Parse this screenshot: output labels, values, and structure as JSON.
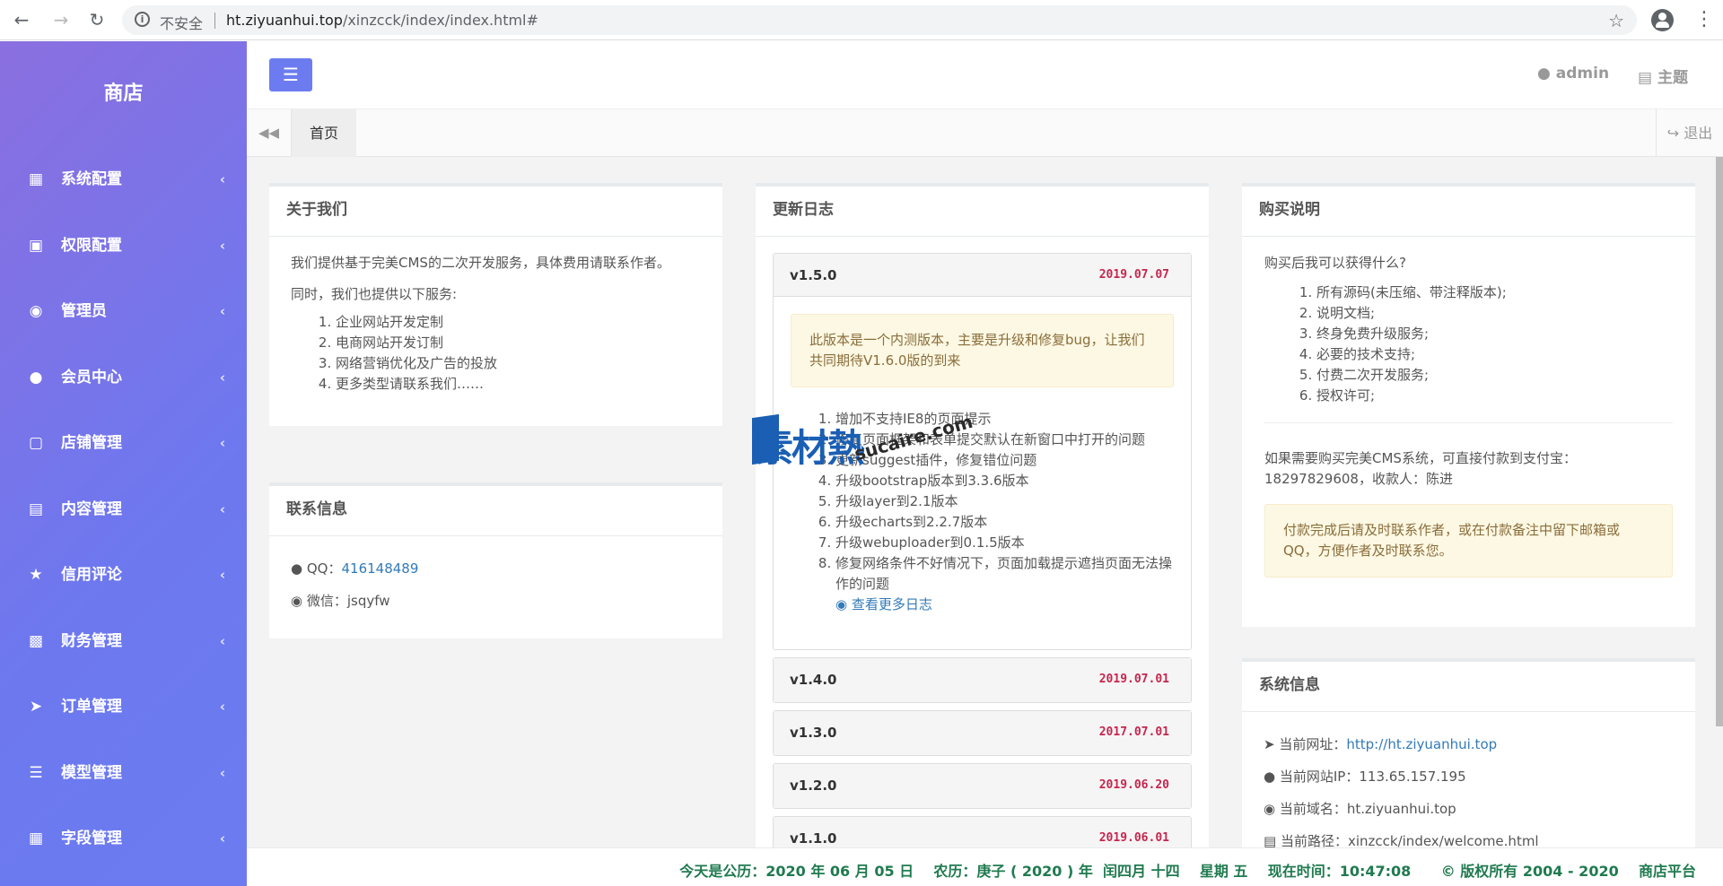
{
  "browser": {
    "insecure_label": "不安全",
    "url_host": "ht.ziyuanhui.top",
    "url_path": "/xinzcck/index/index.html#"
  },
  "sidebar": {
    "brand": "商店",
    "items": [
      {
        "label": "系统配置",
        "icon": "th-icon"
      },
      {
        "label": "权限配置",
        "icon": "lock-icon"
      },
      {
        "label": "管理员",
        "icon": "dot-circle-icon"
      },
      {
        "label": "会员中心",
        "icon": "user-icon"
      },
      {
        "label": "店铺管理",
        "icon": "store-icon"
      },
      {
        "label": "内容管理",
        "icon": "list-icon"
      },
      {
        "label": "信用评论",
        "icon": "star-icon"
      },
      {
        "label": "财务管理",
        "icon": "bar-chart-icon"
      },
      {
        "label": "订单管理",
        "icon": "paper-plane-icon"
      },
      {
        "label": "模型管理",
        "icon": "server-icon"
      },
      {
        "label": "字段管理",
        "icon": "grid-icon"
      }
    ]
  },
  "header": {
    "user": "admin",
    "theme": "主题"
  },
  "tabs": {
    "home": "首页",
    "logout": "退出"
  },
  "about": {
    "title": "关于我们",
    "intro": "我们提供基于完美CMS的二次开发服务，具体费用请联系作者。",
    "services_intro": "同时，我们也提供以下服务:",
    "services": [
      "企业网站开发定制",
      "电商网站开发订制",
      "网络营销优化及广告的投放",
      "更多类型请联系我们……"
    ]
  },
  "contact": {
    "title": "联系信息",
    "qq_label": "QQ：",
    "qq_value": "416148489",
    "wechat_label": "微信：",
    "wechat_value": "jsqyfw"
  },
  "changelog": {
    "title": "更新日志",
    "current": {
      "version": "v1.5.0",
      "date": "2019.07.07",
      "notice": "此版本是一个内测版本，主要是升级和修复bug，让我们共同期待V1.6.0版的到来",
      "items": [
        "增加不支持IE8的页面提示",
        "修复页面框架和表单提交默认在新窗口中打开的问题",
        "更新suggest插件，修复错位问题",
        "升级bootstrap版本到3.3.6版本",
        "升级layer到2.1版本",
        "升级echarts到2.2.7版本",
        "升级webuploader到0.1.5版本",
        "修复网络条件不好情况下，页面加载提示遮挡页面无法操作的问题"
      ],
      "more_link": "查看更多日志"
    },
    "versions": [
      {
        "version": "v1.4.0",
        "date": "2019.07.01"
      },
      {
        "version": "v1.3.0",
        "date": "2017.07.01"
      },
      {
        "version": "v1.2.0",
        "date": "2019.06.20"
      },
      {
        "version": "v1.1.0",
        "date": "2019.06.01"
      }
    ]
  },
  "purchase": {
    "title": "购买说明",
    "question": "购买后我可以获得什么?",
    "items": [
      "所有源码(未压缩、带注释版本);",
      "说明文档;",
      "终身免费升级服务;",
      "必要的技术支持;",
      "付费二次开发服务;",
      "授权许可;"
    ],
    "pay_info": "如果需要购买完美CMS系统，可直接付款到支付宝：18297829608，收款人：陈进",
    "notice": "付款完成后请及时联系作者，或在付款备注中留下邮箱或QQ，方便作者及时联系您。"
  },
  "sysinfo": {
    "title": "系统信息",
    "url_label": "当前网址：",
    "url_value": "http://ht.ziyuanhui.top",
    "ip_label": "当前网站IP：",
    "ip_value": "113.65.157.195",
    "domain_label": "当前域名：",
    "domain_value": "ht.ziyuanhui.top",
    "path_label": "当前路径：",
    "path_value": "xinzcck/index/welcome.html"
  },
  "footer": {
    "text": "今天是公历：2020 年 06 月 05 日    农历：庚子 ( 2020 ) 年  闰四月 十四    星期 五    现在时间：10:47:08      © 版权所有 2004 - 2020    商店平台"
  },
  "watermark": {
    "cn": "素材熱",
    "en": "sucaire.com"
  }
}
